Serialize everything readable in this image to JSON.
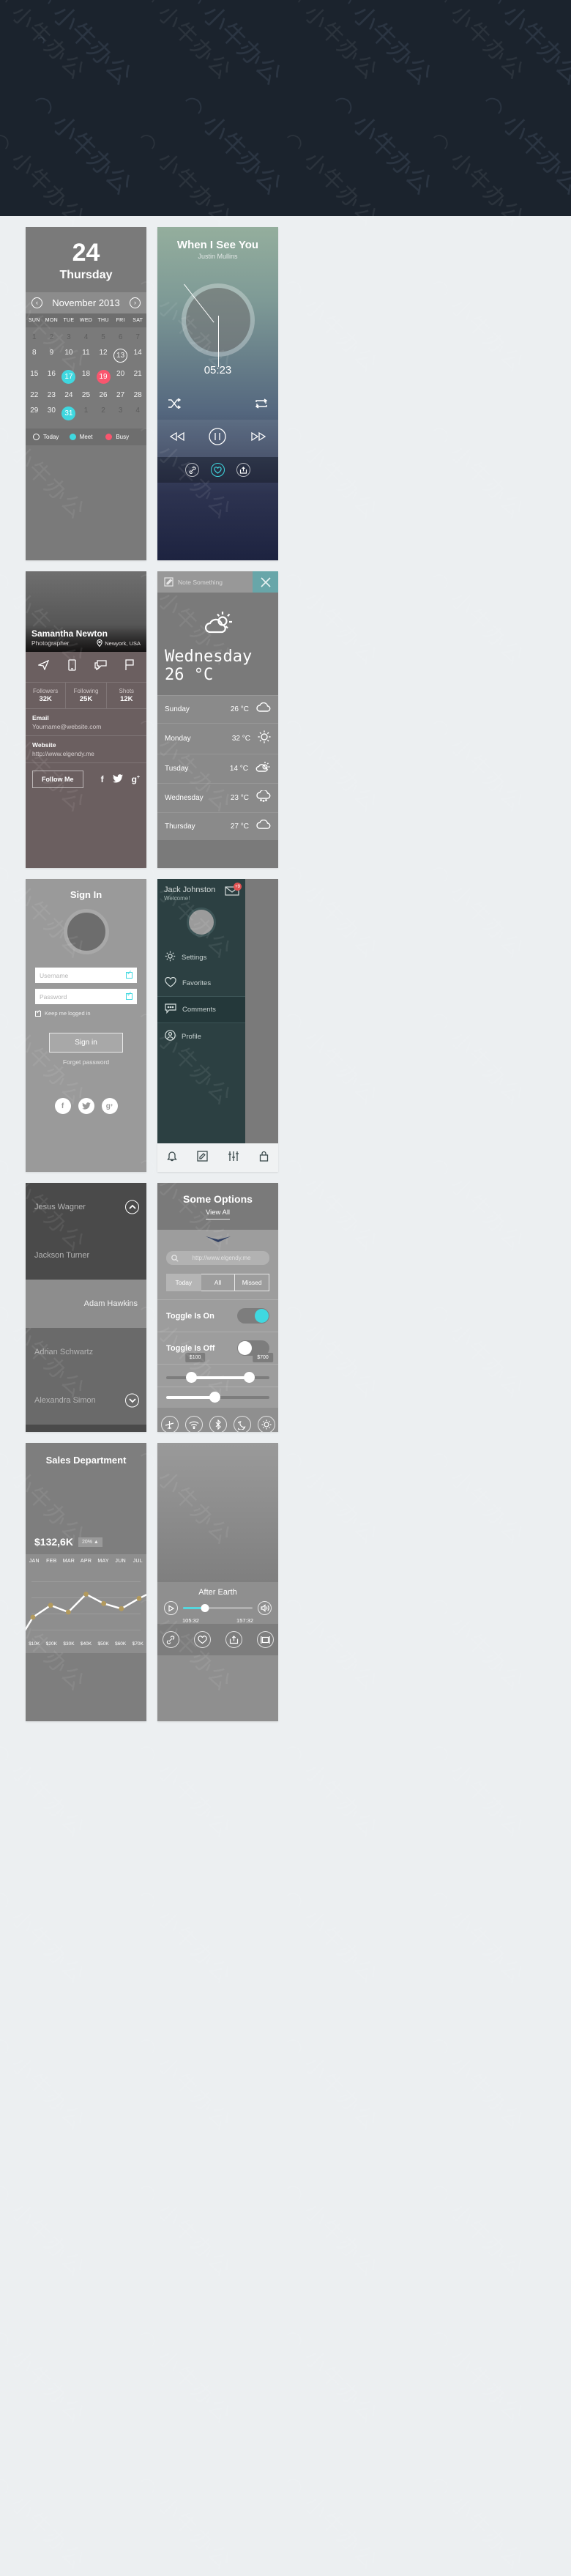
{
  "calendar": {
    "day_number": "24",
    "day_name": "Thursday",
    "month_label": "November 2013",
    "prev_icon": "chevron-left-icon",
    "next_icon": "chevron-right-icon",
    "dow": [
      "SUN",
      "MON",
      "TUE",
      "WED",
      "THU",
      "FRI",
      "SAT"
    ],
    "cells": [
      {
        "n": "1",
        "s": "dim"
      },
      {
        "n": "2",
        "s": "dim"
      },
      {
        "n": "3",
        "s": "dim"
      },
      {
        "n": "4",
        "s": "dim"
      },
      {
        "n": "5",
        "s": "dim"
      },
      {
        "n": "6",
        "s": "dim"
      },
      {
        "n": "7",
        "s": "dim"
      },
      {
        "n": "8",
        "s": ""
      },
      {
        "n": "9",
        "s": ""
      },
      {
        "n": "10",
        "s": ""
      },
      {
        "n": "11",
        "s": ""
      },
      {
        "n": "12",
        "s": ""
      },
      {
        "n": "13",
        "s": "today"
      },
      {
        "n": "14",
        "s": ""
      },
      {
        "n": "15",
        "s": ""
      },
      {
        "n": "16",
        "s": ""
      },
      {
        "n": "17",
        "s": "meet"
      },
      {
        "n": "18",
        "s": ""
      },
      {
        "n": "19",
        "s": "busy"
      },
      {
        "n": "20",
        "s": ""
      },
      {
        "n": "21",
        "s": ""
      },
      {
        "n": "22",
        "s": ""
      },
      {
        "n": "23",
        "s": ""
      },
      {
        "n": "24",
        "s": ""
      },
      {
        "n": "25",
        "s": ""
      },
      {
        "n": "26",
        "s": ""
      },
      {
        "n": "27",
        "s": ""
      },
      {
        "n": "28",
        "s": ""
      },
      {
        "n": "29",
        "s": ""
      },
      {
        "n": "30",
        "s": ""
      },
      {
        "n": "31",
        "s": "meet"
      },
      {
        "n": "1",
        "s": "dim"
      },
      {
        "n": "2",
        "s": "dim"
      },
      {
        "n": "3",
        "s": "dim"
      },
      {
        "n": "4",
        "s": "dim"
      }
    ],
    "legend": [
      {
        "label": "Today",
        "color": "#ffffff",
        "style": "hollow"
      },
      {
        "label": "Meet",
        "color": "#3fd8e0",
        "style": "cyan"
      },
      {
        "label": "Busy",
        "color": "#f9566e",
        "style": "red"
      }
    ]
  },
  "player": {
    "title": "When I See You",
    "artist": "Justin Mullins",
    "time": "05:23",
    "shuffle_icon": "shuffle-icon",
    "repeat_icon": "repeat-icon",
    "prev_icon": "rewind-icon",
    "play_icon": "pause-icon",
    "next_icon": "fast-forward-icon",
    "link_icon": "link-icon",
    "heart_icon": "heart-icon",
    "share_icon": "share-icon"
  },
  "profile": {
    "name": "Samantha Newton",
    "role": "Photographer",
    "location": "Newyork, USA",
    "location_icon": "map-pin-icon",
    "action_icons": [
      "send-icon",
      "phone-icon",
      "chat-icon",
      "flag-icon"
    ],
    "stats": [
      {
        "key": "Followers",
        "value": "32K"
      },
      {
        "key": "Following",
        "value": "25K"
      },
      {
        "key": "Shots",
        "value": "12K"
      }
    ],
    "email_label": "Email",
    "email_value": "Yourname@website.com",
    "website_label": "Website",
    "website_value": "http://www.elgendy.me",
    "follow_label": "Follow Me",
    "social": [
      "f",
      "twitter-icon",
      "g+"
    ]
  },
  "weather": {
    "note_placeholder": "Note Something",
    "note_icon": "edit-square-icon",
    "close_icon": "close-icon",
    "hero_icon": "partly-cloudy-icon",
    "today_day": "Wednesday",
    "today_temp": "26 °C",
    "forecast": [
      {
        "day": "Sunday",
        "temp": "26 °C",
        "icon": "cloud-icon"
      },
      {
        "day": "Monday",
        "temp": "32 °C",
        "icon": "sun-icon"
      },
      {
        "day": "Tusday",
        "temp": "14 °C",
        "icon": "partly-cloudy-icon"
      },
      {
        "day": "Wednesday",
        "temp": "23 °C",
        "icon": "snow-cloud-icon"
      },
      {
        "day": "Thursday",
        "temp": "27 °C",
        "icon": "cloud-icon"
      }
    ]
  },
  "signin": {
    "title": "Sign In",
    "avatar": "avatar-placeholder",
    "username_placeholder": "Username",
    "password_placeholder": "Password",
    "keep_logged_label": "Keep me logged in",
    "submit_label": "Sign in",
    "forgot_label": "Forget password",
    "social": [
      "f",
      "twitter-icon",
      "g+"
    ],
    "check_color": "#3fd8e0"
  },
  "drawer": {
    "name": "Jack Johnston",
    "welcome": "Welcome!",
    "mail_icon": "mail-icon",
    "badge": "+9",
    "badge_color": "#e05252",
    "items": [
      {
        "label": "Settings",
        "icon": "gear-icon",
        "active": false
      },
      {
        "label": "Favorites",
        "icon": "heart-icon",
        "active": false
      },
      {
        "label": "Comments",
        "icon": "comment-icon",
        "active": true
      },
      {
        "label": "Profile",
        "icon": "user-icon",
        "active": false
      }
    ],
    "tabbar": [
      "bell-icon",
      "edit-icon",
      "sliders-icon",
      "lock-icon"
    ]
  },
  "names": {
    "rows": [
      {
        "label": "Jesus Wagner",
        "style": "dark",
        "chevron": "chevron-up-icon"
      },
      {
        "label": "Jackson Turner",
        "style": "dark"
      },
      {
        "label": "Adam Hawkins",
        "style": "light"
      },
      {
        "label": "Adrian Schwartz",
        "style": "mid"
      },
      {
        "label": "Alexandra Simon",
        "style": "mid",
        "chevron": "chevron-down-icon"
      }
    ]
  },
  "options": {
    "title": "Some Options",
    "view_all": "View All",
    "search_icon": "search-icon",
    "search_placeholder": "http://www.elgendy.me",
    "segments": [
      {
        "label": "Today",
        "selected": true
      },
      {
        "label": "All",
        "selected": false
      },
      {
        "label": "Missed",
        "selected": false
      }
    ],
    "toggle_on_label": "Toggle Is On",
    "toggle_off_label": "Toggle Is Off",
    "toggle_on_color": "#3fd8e0",
    "range": {
      "min_label": "$100",
      "max_label": "$700",
      "min_pct": 24,
      "max_pct": 80
    },
    "slider_pct": 47,
    "actions": [
      "airplane-icon",
      "wifi-icon",
      "bluetooth-icon",
      "moon-icon",
      "brightness-icon"
    ]
  },
  "sales": {
    "title": "Sales Department",
    "amount": "$132,6K",
    "delta": "20% ▲"
  },
  "chart_data": {
    "type": "line",
    "title": "Sales Department",
    "categories": [
      "JAN",
      "FEB",
      "MAR",
      "APR",
      "MAY",
      "JUN",
      "JUL"
    ],
    "values": [
      18,
      32,
      24,
      45,
      34,
      28,
      40
    ],
    "x_tick_labels": [
      "JAN",
      "FEB",
      "MAR",
      "APR",
      "MAY",
      "JUN",
      "JUL"
    ],
    "bottom_axis_labels": [
      "$10K",
      "$20K",
      "$30K",
      "$40K",
      "$50K",
      "$60K",
      "$70K"
    ],
    "xlabel": "",
    "ylabel": "",
    "ylim": [
      0,
      60
    ],
    "grid": true,
    "legend": "none",
    "line_color": "#ffffff",
    "marker_color": "#b39a5d",
    "annotation_amount": "$132,6K",
    "annotation_delta": "20% ▲"
  },
  "video": {
    "title": "After Earth",
    "play_icon": "play-icon",
    "volume_icon": "volume-icon",
    "time_current": "105:32",
    "time_total": "157:32",
    "progress_pct": 32,
    "progress_color": "#55d6de",
    "actions": [
      "link-icon",
      "heart-icon",
      "share-icon",
      "fullscreen-icon"
    ]
  }
}
